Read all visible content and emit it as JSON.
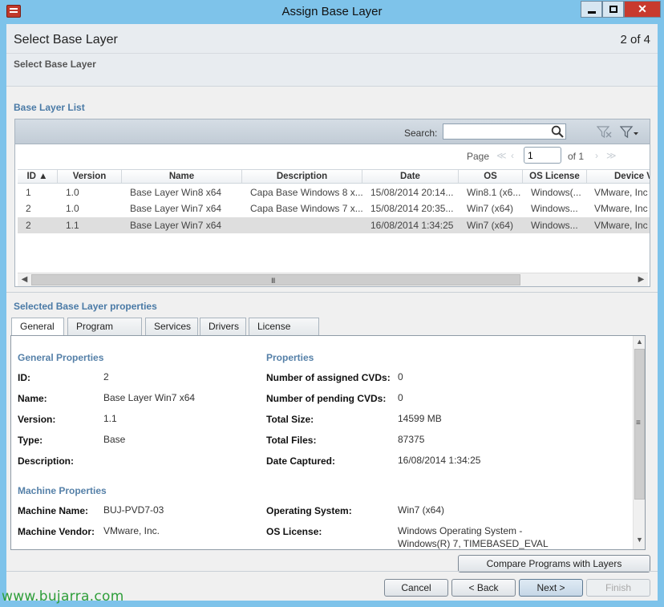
{
  "window": {
    "title": "Assign Base Layer",
    "close_glyph": "✕"
  },
  "header": {
    "page_title": "Select Base Layer",
    "step": "2 of 4",
    "subtitle": "Select Base Layer"
  },
  "base_layer_list": {
    "section_label": "Base Layer List",
    "search_label": "Search:",
    "search_value": "",
    "pager": {
      "page_label": "Page",
      "current_page": "1",
      "of_pages": "of 1"
    },
    "columns": [
      {
        "key": "id",
        "label": "ID ▲"
      },
      {
        "key": "version",
        "label": "Version"
      },
      {
        "key": "name",
        "label": "Name"
      },
      {
        "key": "description",
        "label": "Description"
      },
      {
        "key": "date",
        "label": "Date"
      },
      {
        "key": "os",
        "label": "OS"
      },
      {
        "key": "os_license",
        "label": "OS License"
      },
      {
        "key": "device",
        "label": "Device V"
      }
    ],
    "rows": [
      {
        "id": "1",
        "version": "1.0",
        "name": "Base Layer Win8 x64",
        "description": "Capa Base Windows 8 x...",
        "date": "15/08/2014 20:14...",
        "os": "Win8.1 (x6...",
        "os_license": "Windows(...",
        "device": "VMware, Inc"
      },
      {
        "id": "2",
        "version": "1.0",
        "name": "Base Layer Win7 x64",
        "description": "Capa Base Windows 7 x...",
        "date": "15/08/2014 20:35...",
        "os": "Win7 (x64)",
        "os_license": "Windows...",
        "device": "VMware, Inc"
      },
      {
        "id": "2",
        "version": "1.1",
        "name": "Base Layer Win7 x64",
        "description": "",
        "date": "16/08/2014 1:34:25",
        "os": "Win7 (x64)",
        "os_license": "Windows...",
        "device": "VMware, Inc"
      }
    ],
    "selected_row": 2,
    "scroll_grip": "III"
  },
  "properties": {
    "section_label": "Selected Base Layer properties",
    "tabs": [
      "General",
      "Program Files",
      "Services",
      "Drivers",
      "License Keys"
    ],
    "active_tab": "General",
    "general_heading": "General Properties",
    "props_heading": "Properties",
    "machine_heading": "Machine Properties",
    "general": {
      "id_label": "ID:",
      "id": "2",
      "name_label": "Name:",
      "name": "Base Layer Win7 x64",
      "version_label": "Version:",
      "version": "1.1",
      "type_label": "Type:",
      "type": "Base",
      "description_label": "Description:",
      "description": ""
    },
    "props": {
      "assigned_label": "Number of assigned CVDs:",
      "assigned": "0",
      "pending_label": "Number of pending CVDs:",
      "pending": "0",
      "size_label": "Total Size:",
      "size": "14599 MB",
      "files_label": "Total Files:",
      "files": "87375",
      "captured_label": "Date Captured:",
      "captured": "16/08/2014 1:34:25"
    },
    "machine": {
      "name_label": "Machine Name:",
      "name": "BUJ-PVD7-03",
      "vendor_label": "Machine Vendor:",
      "vendor": "VMware, Inc.",
      "os_label": "Operating System:",
      "os": "Win7 (x64)",
      "license_label": "OS License:",
      "license_line1": "Windows Operating System -",
      "license_line2": "Windows(R) 7, TIMEBASED_EVAL"
    }
  },
  "buttons": {
    "compare": "Compare Programs with Layers",
    "cancel": "Cancel",
    "back": "< Back",
    "next": "Next >",
    "finish": "Finish"
  },
  "watermark": "www.bujarra.com",
  "colors": {
    "window_frame": "#7ec3ea",
    "section_heading": "#4a7aa6",
    "close_button": "#c83a2e",
    "watermark": "#2e9e3a"
  }
}
